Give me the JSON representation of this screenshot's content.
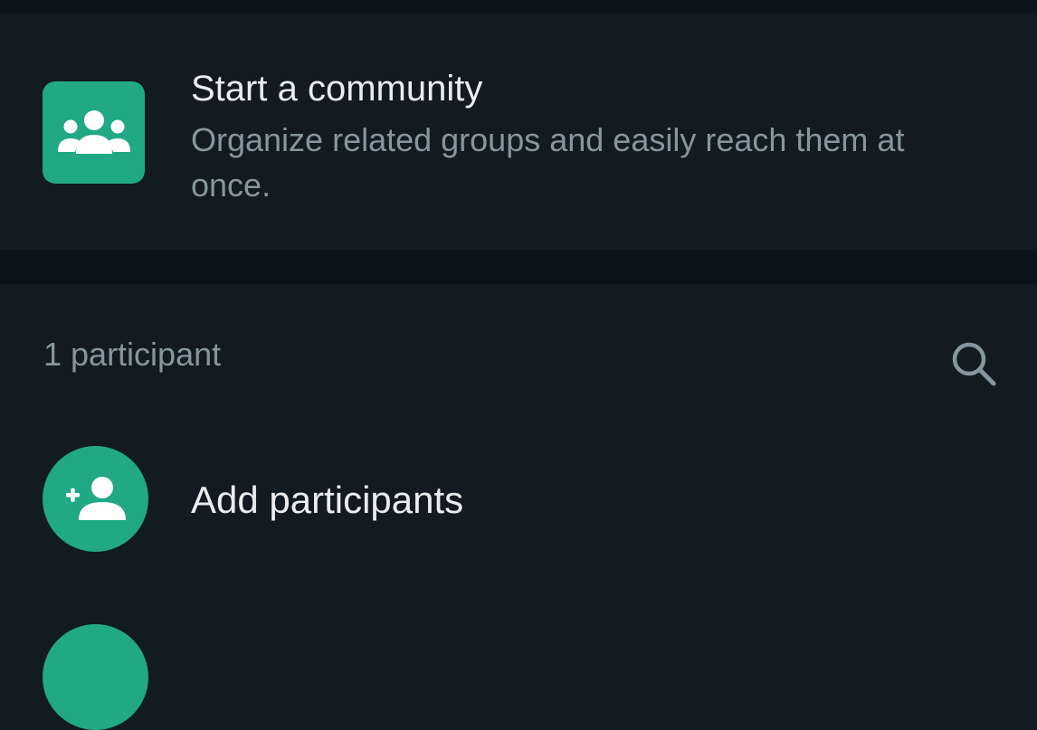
{
  "community": {
    "title": "Start a community",
    "description": "Organize related groups and easily reach them at once.",
    "icon": "community-icon"
  },
  "participants": {
    "count_label": "1 participant",
    "search_icon": "search-icon",
    "add_label": "Add participants",
    "add_icon": "add-person-icon"
  },
  "colors": {
    "accent": "#21a884",
    "background": "#111b21",
    "separator": "#0b141a",
    "primary_text": "#e9edef",
    "secondary_text": "#8696a0"
  }
}
